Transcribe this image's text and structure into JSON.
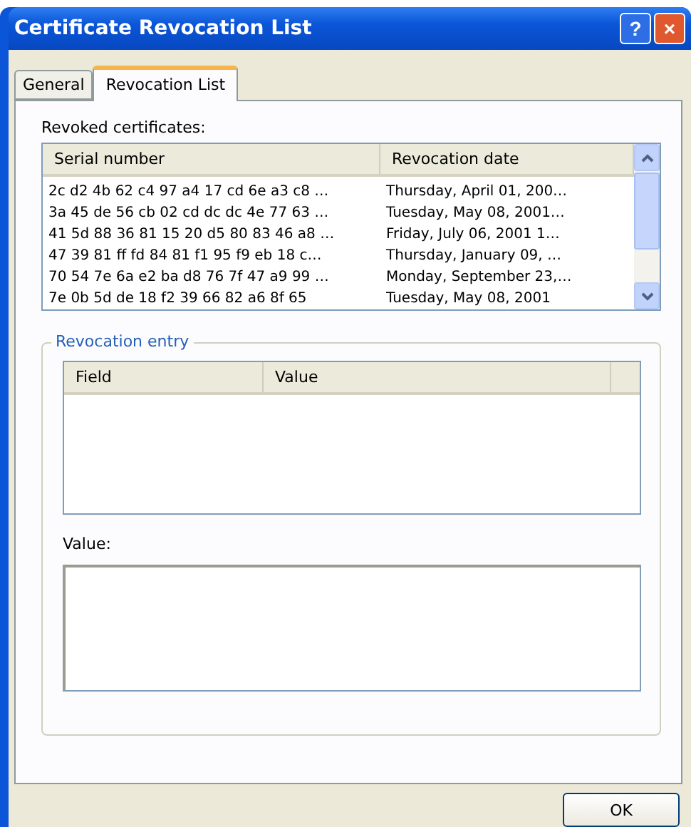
{
  "window": {
    "title": "Certificate Revocation List",
    "title_buttons": [
      "?",
      "×"
    ]
  },
  "tabs": [
    {
      "label": "General",
      "selected": false
    },
    {
      "label": "Revocation List",
      "selected": true
    }
  ],
  "revoked_label": "Revoked certificates:",
  "revoked_list": {
    "columns": [
      "Serial number",
      "Revocation date"
    ],
    "rows": [
      [
        "2c d2 4b 62 c4 97 a4 17 cd 6e a3 c8 …",
        "Thursday, April 01, 200…"
      ],
      [
        "3a 45 de 56 cb 02 cd dc dc 4e 77 63 …",
        "Tuesday, May 08, 2001…"
      ],
      [
        "41 5d 88 36 81 15 20 d5 80 83 46 a8 …",
        "Friday, July 06, 2001 1…"
      ],
      [
        "47 39 81 ff fd 84 81 f1 95 f9 eb 18 c…",
        "Thursday, January 09, …"
      ],
      [
        "70 54 7e 6a e2 ba d8 76 7f 47 a9 99 …",
        "Monday, September 23,…"
      ],
      [
        "7e 0b 5d de 18 f2 39 66 82 a6 8f 65",
        "Tuesday, May 08, 2001"
      ]
    ]
  },
  "entry_group": {
    "title": "Revocation entry",
    "columns": [
      "Field",
      "Value"
    ],
    "value_label": "Value:"
  },
  "buttons": [
    "OK"
  ]
}
